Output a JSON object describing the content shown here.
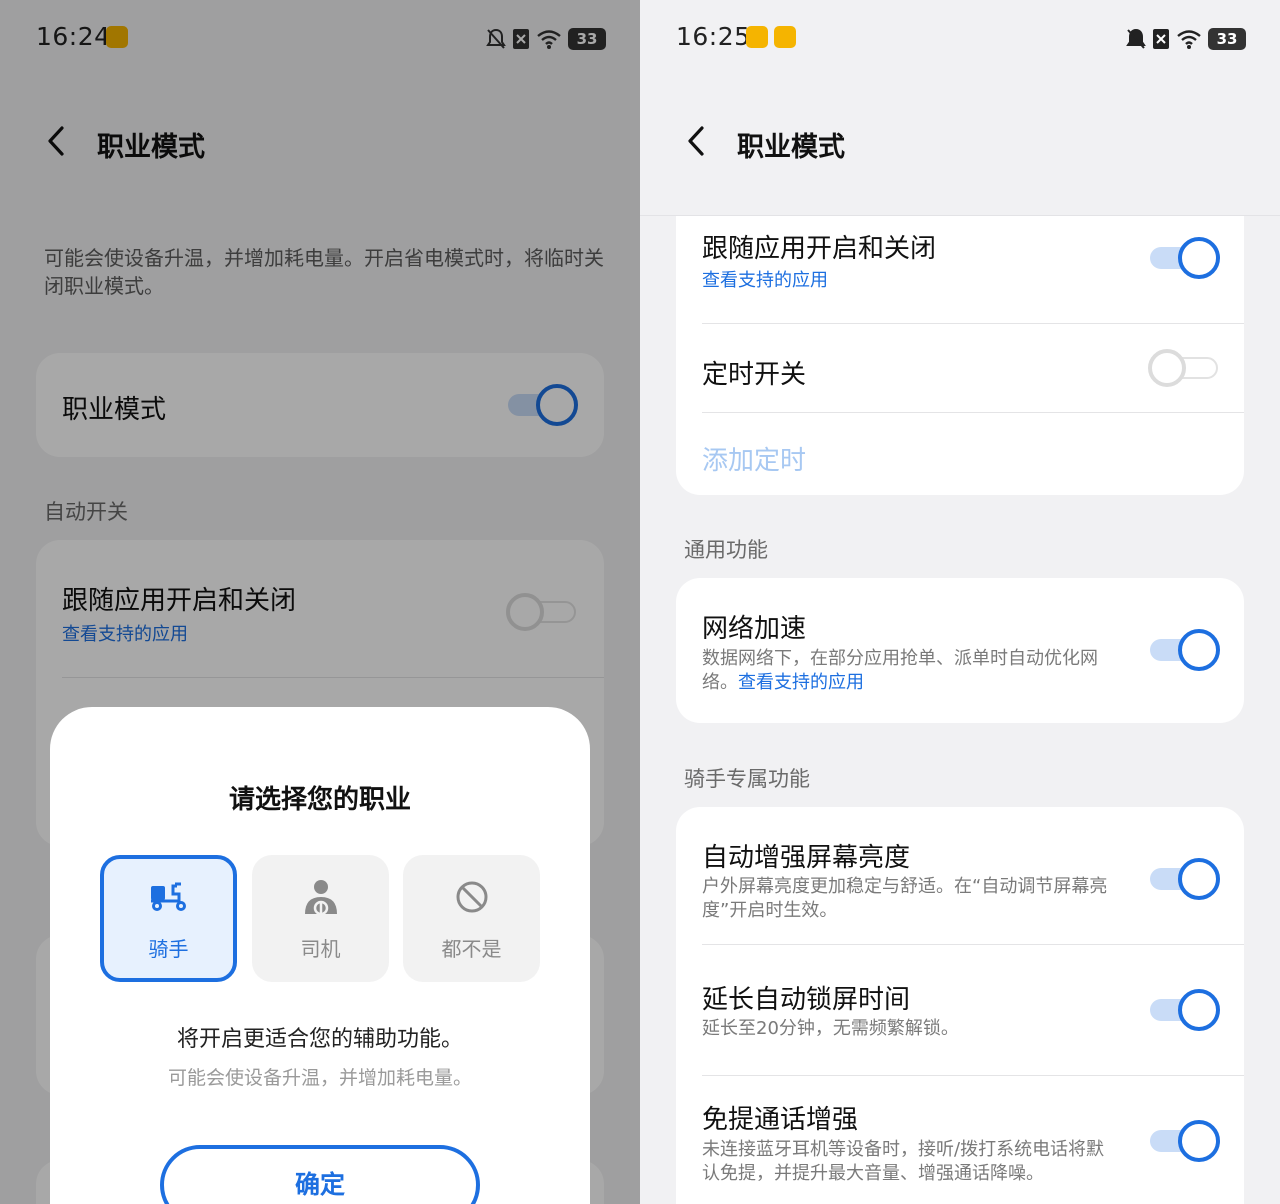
{
  "left": {
    "status": {
      "time": "16:24",
      "battery": "33"
    },
    "header": {
      "title": "职业模式"
    },
    "description": "可能会使设备升温，并增加耗电量。开启省电模式时，将临时关闭职业模式。",
    "mode_row": {
      "title": "职业模式",
      "enabled": true
    },
    "auto_section": {
      "label": "自动开关"
    },
    "follow_app_row": {
      "title": "跟随应用开启和关闭",
      "link": "查看支持的应用",
      "enabled": false
    },
    "dialog": {
      "title": "请选择您的职业",
      "options": [
        {
          "label": "骑手",
          "icon": "scooter-icon",
          "selected": true
        },
        {
          "label": "司机",
          "icon": "driver-icon",
          "selected": false
        },
        {
          "label": "都不是",
          "icon": "none-icon",
          "selected": false
        }
      ],
      "main_text": "将开启更适合您的辅助功能。",
      "sub_text": "可能会使设备升温，并增加耗电量。",
      "confirm_label": "确定"
    }
  },
  "right": {
    "status": {
      "time": "16:25",
      "battery": "33"
    },
    "header": {
      "title": "职业模式"
    },
    "follow_app_row": {
      "title": "跟随应用开启和关闭",
      "link": "查看支持的应用",
      "enabled": true
    },
    "timer_row": {
      "title": "定时开关",
      "enabled": false
    },
    "add_timer": {
      "label": "添加定时"
    },
    "general_section": {
      "label": "通用功能"
    },
    "network_row": {
      "title": "网络加速",
      "desc": "数据网络下，在部分应用抢单、派单时自动优化网络。",
      "link": "查看支持的应用",
      "enabled": true
    },
    "rider_section": {
      "label": "骑手专属功能"
    },
    "brightness_row": {
      "title": "自动增强屏幕亮度",
      "desc": "户外屏幕亮度更加稳定与舒适。在“自动调节屏幕亮度”开启时生效。",
      "enabled": true
    },
    "lock_row": {
      "title": "延长自动锁屏时间",
      "desc": "延长至20分钟，无需频繁解锁。",
      "enabled": true
    },
    "handsfree_row": {
      "title": "免提通话增强",
      "desc": "未连接蓝牙耳机等设备时，接听/拨打系统电话将默认免提，并提升最大音量、增强通话降噪。",
      "enabled": true
    }
  },
  "colors": {
    "accent": "#1d6fe0",
    "background": "#f1f1f3",
    "card": "#ffffff"
  }
}
